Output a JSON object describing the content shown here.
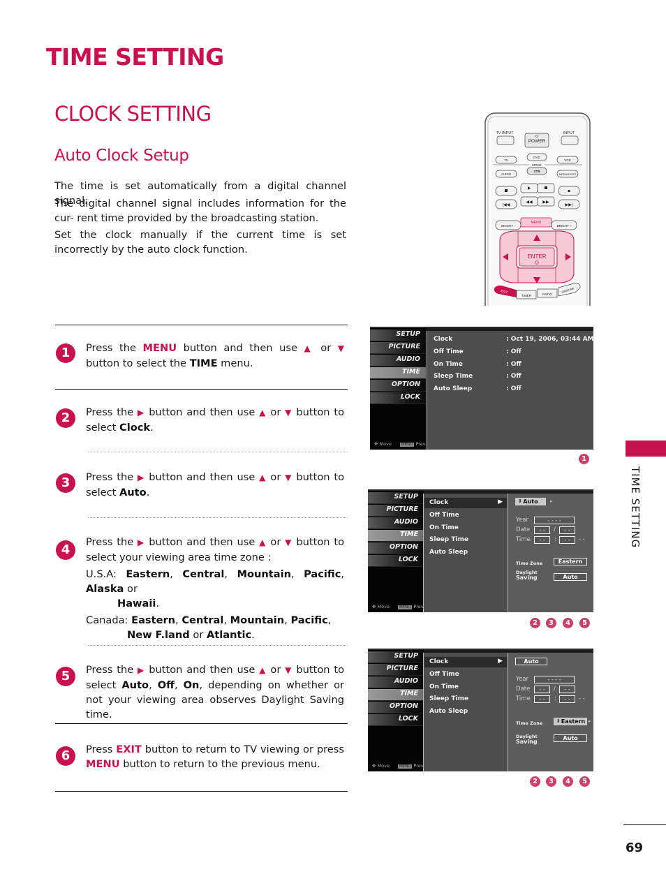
{
  "page": {
    "title": "TIME SETTING",
    "section_title": "CLOCK SETTING",
    "subsection_title": "Auto Clock Setup",
    "side_tab_label": "TIME SETTING",
    "page_number": "69",
    "accent_color": "#c8114f"
  },
  "intro": [
    "The time is set automatically from a digital channel signal.",
    "The digital channel signal includes information for the cur- rent time provided by the broadcasting station.",
    "Set the clock manually if the current time is set incorrectly by the auto clock function."
  ],
  "remote": {
    "buttons": {
      "tv_input": "TV INPUT",
      "power": "POWER",
      "input": "INPUT",
      "tv": "TV",
      "dvd": "DVD",
      "vcr": "VCR",
      "mode": "MODE",
      "audio": "AUDIO",
      "stb": "STB",
      "media_host": "MEDIA HOST",
      "bright_minus": "BRIGHT -",
      "menu": "MENU",
      "bright_plus": "BRIGHT +",
      "enter": "ENTER",
      "exit": "EXIT",
      "timer": "TIMER",
      "ratio": "RATIO",
      "simplink": "SIMPLINK"
    }
  },
  "steps": [
    {
      "num": "1",
      "parts": {
        "a": "Press the ",
        "kw1": "MENU",
        "b": " button and then use ",
        "up": "▲",
        "c": " or ",
        "down": "▼",
        "d": " button to select the ",
        "bold1": "TIME",
        "e": " menu."
      }
    },
    {
      "num": "2",
      "parts": {
        "a": "Press the ",
        "right": "▶",
        "b": " button and then use ",
        "up": "▲",
        "c": " or ",
        "down": "▼",
        "d": " button to select ",
        "bold1": "Clock",
        "e": "."
      }
    },
    {
      "num": "3",
      "parts": {
        "a": "Press the ",
        "right": "▶",
        "b": " button and then use ",
        "up": "▲",
        "c": " or ",
        "down": "▼",
        "d": " button to select ",
        "bold1": "Auto",
        "e": "."
      }
    },
    {
      "num": "4",
      "parts": {
        "a": "Press the ",
        "right": "▶",
        "b": " button and then use ",
        "up": "▲",
        "c": " or ",
        "down": "▼",
        "d": " button to select your viewing area time zone :"
      },
      "usa_label": "U.S.A: ",
      "usa_zones": [
        "Eastern",
        "Central",
        "Mountain",
        "Pacific",
        "Alaska",
        "Hawaii"
      ],
      "canada_label": "Canada: ",
      "canada_zones": [
        "Eastern",
        "Central",
        "Mountain",
        "Pacific",
        "New F.land",
        "Atlantic"
      ],
      "sep": ", ",
      "or": " or ",
      "end": "."
    },
    {
      "num": "5",
      "parts": {
        "a": "Press the ",
        "right": "▶",
        "b": " button and then use ",
        "up": "▲",
        "c": " or ",
        "down": "▼",
        "d": " button to select ",
        "bold1": "Auto",
        "s1": ", ",
        "bold2": "Off",
        "s2": ", ",
        "bold3": "On",
        "e": ", depending on whether or not your viewing area observes Daylight Saving time."
      }
    },
    {
      "num": "6",
      "parts": {
        "a": "Press ",
        "kw1": "EXIT",
        "b": " button to return to TV viewing or press ",
        "kw2": "MENU",
        "c": " button to return to the previous menu."
      }
    }
  ],
  "tv_menu": {
    "side_items": [
      "SETUP",
      "PICTURE",
      "AUDIO",
      "TIME",
      "OPTION",
      "LOCK"
    ],
    "active_item": "TIME",
    "footer_move": "Move",
    "footer_menu": "MENU",
    "footer_prev": "Prev"
  },
  "screen1": {
    "rows": [
      {
        "label": "Clock",
        "value": ": Oct 19, 2006, 03:44 AM"
      },
      {
        "label": "Off Time",
        "value": ": Off"
      },
      {
        "label": "On Time",
        "value": ": Off"
      },
      {
        "label": "Sleep Time",
        "value": ": Off"
      },
      {
        "label": "Auto Sleep",
        "value": ": Off"
      }
    ],
    "badges": [
      "1"
    ]
  },
  "screen2": {
    "rows": [
      "Clock",
      "Off Time",
      "On Time",
      "Sleep Time",
      "Auto Sleep"
    ],
    "selected": "Clock",
    "mode": "Auto",
    "year_label": "Year",
    "year_value": "- - - -",
    "date_label": "Date",
    "date_month": "- -",
    "date_sep": "/",
    "date_day": "- -",
    "time_label": "Time",
    "time_hour": "- -",
    "time_sep": ":",
    "time_min": "- -",
    "time_ampm": "- -",
    "tz_label": "Time Zone",
    "tz_value": "Eastern",
    "dst_label1": "Daylight",
    "dst_label2": "Saving",
    "dst_value": "Auto",
    "badges": [
      "2",
      "3",
      "4",
      "5"
    ]
  },
  "screen3": {
    "rows": [
      "Clock",
      "Off Time",
      "On Time",
      "Sleep Time",
      "Auto Sleep"
    ],
    "selected": "Clock",
    "mode": "Auto",
    "year_label": "Year",
    "year_value": "- - - -",
    "date_label": "Date",
    "date_month": "- -",
    "date_sep": "/",
    "date_day": "- -",
    "time_label": "Time",
    "time_hour": "- -",
    "time_sep": ":",
    "time_min": "- -",
    "time_ampm": "- -",
    "tz_label": "Time Zone",
    "tz_value": "Eastern",
    "dst_label1": "Daylight",
    "dst_label2": "Saving",
    "dst_value": "Auto",
    "badges": [
      "2",
      "3",
      "4",
      "5"
    ]
  }
}
